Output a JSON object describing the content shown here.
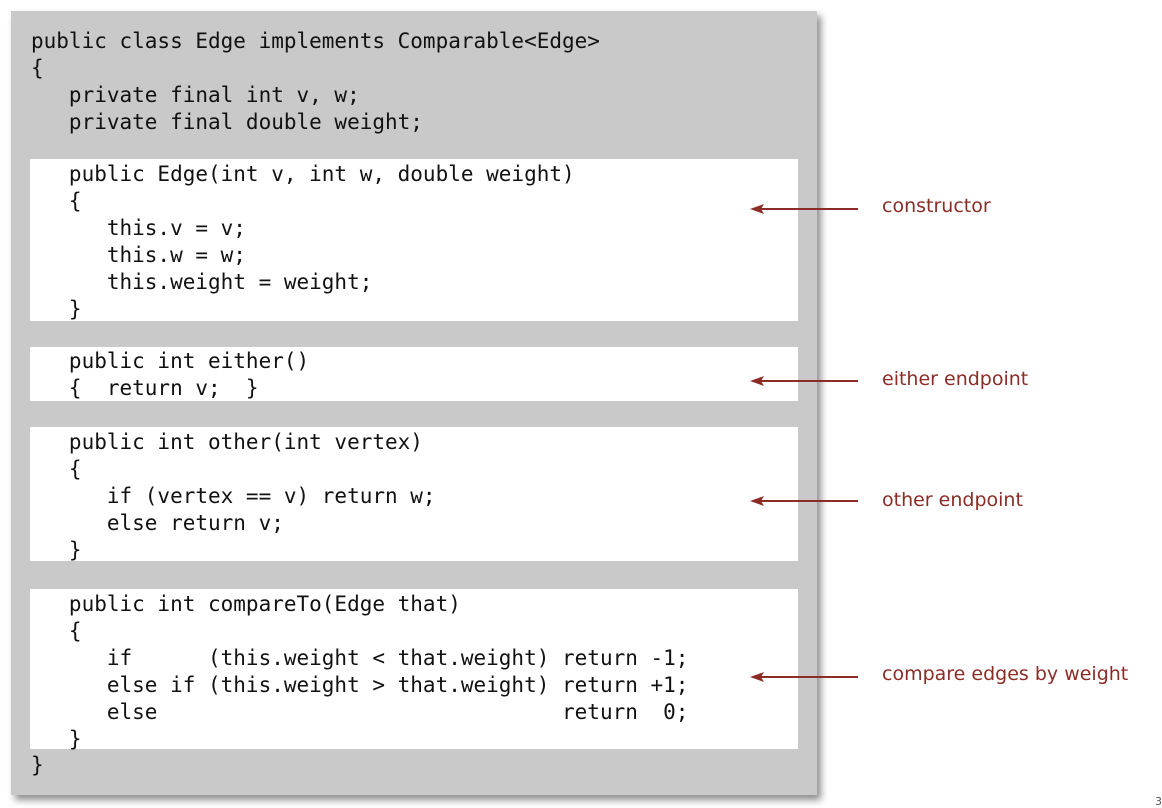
{
  "code": {
    "header_lines": [
      "public class Edge implements Comparable<Edge>",
      "{",
      "   private final int v, w;",
      "   private final double weight;"
    ],
    "constructor_lines": [
      "   public Edge(int v, int w, double weight)",
      "   {",
      "      this.v = v;",
      "      this.w = w;",
      "      this.weight = weight;",
      "   }"
    ],
    "either_lines": [
      "   public int either()",
      "   {  return v;  }"
    ],
    "other_lines": [
      "   public int other(int vertex)",
      "   {",
      "      if (vertex == v) return w;",
      "      else return v;",
      "   }"
    ],
    "compare_lines": [
      "   public int compareTo(Edge that)",
      "   {",
      "      if      (this.weight < that.weight) return -1;",
      "      else if (this.weight > that.weight) return +1;",
      "      else                                return  0;",
      "   }"
    ],
    "closing_line": "}"
  },
  "annotations": {
    "constructor": "constructor",
    "either": "either endpoint",
    "other": "other endpoint",
    "compare": "compare edges by weight"
  },
  "colors": {
    "panel_background": "#c9c9c9",
    "highlight_background": "#ffffff",
    "annotation_color": "#8b2c26",
    "code_color": "#111111"
  },
  "page_number": "3"
}
